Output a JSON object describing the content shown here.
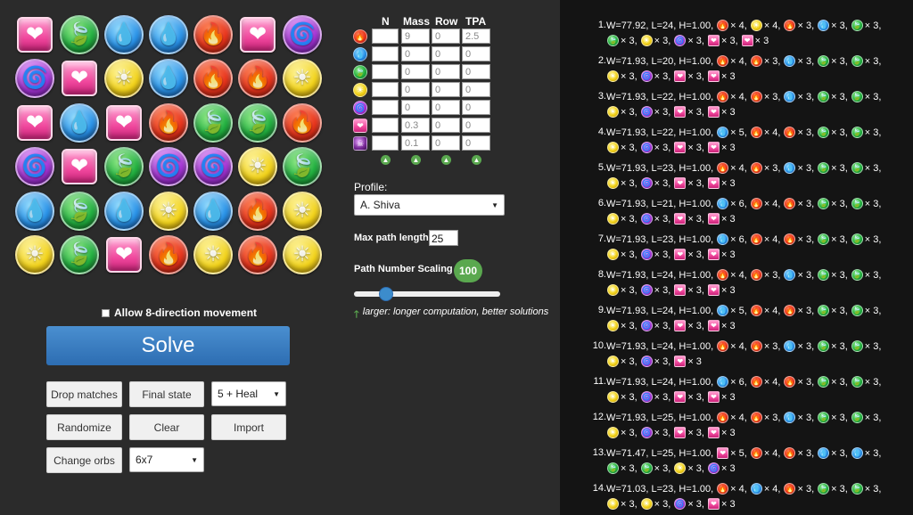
{
  "board": {
    "rows": [
      [
        "h",
        "g",
        "b",
        "b",
        "r",
        "h",
        "d"
      ],
      [
        "d",
        "h",
        "l",
        "b",
        "r",
        "r",
        "l"
      ],
      [
        "h",
        "b",
        "h",
        "r",
        "g",
        "g",
        "r"
      ],
      [
        "d",
        "h",
        "g",
        "d",
        "d",
        "l",
        "g"
      ],
      [
        "b",
        "g",
        "b",
        "l",
        "b",
        "r",
        "l"
      ],
      [
        "l",
        "g",
        "h",
        "r",
        "l",
        "r",
        "l"
      ]
    ],
    "orb_glyphs": {
      "r": "🔥",
      "b": "💧",
      "g": "🍃",
      "l": "☀",
      "d": "🌀",
      "h": "❤"
    }
  },
  "weights": {
    "headers": [
      "N",
      "Mass",
      "Row",
      "TPA"
    ],
    "rows": [
      {
        "orb": "fire",
        "n": "",
        "mass": "9",
        "row": "0",
        "tpa": "2.5"
      },
      {
        "orb": "water",
        "n": "",
        "mass": "0",
        "row": "0",
        "tpa": "0"
      },
      {
        "orb": "wood",
        "n": "",
        "mass": "0",
        "row": "0",
        "tpa": "0"
      },
      {
        "orb": "light",
        "n": "",
        "mass": "0",
        "row": "0",
        "tpa": "0"
      },
      {
        "orb": "dark",
        "n": "",
        "mass": "0",
        "row": "0",
        "tpa": "0"
      },
      {
        "orb": "heart",
        "n": "",
        "mass": "0.3",
        "row": "0",
        "tpa": "0"
      },
      {
        "orb": "poison",
        "n": "",
        "mass": "0.1",
        "row": "0",
        "tpa": "0"
      }
    ]
  },
  "profile": {
    "label": "Profile:",
    "value": "A. Shiva"
  },
  "max_path": {
    "label": "Max path length:",
    "value": "25"
  },
  "scaling": {
    "label": "Path Number Scaling",
    "value": "100",
    "slider_fraction": 0.2
  },
  "hint": {
    "text": "larger: longer computation, better solutions"
  },
  "allow8": {
    "label": "Allow 8-direction movement",
    "checked": false
  },
  "buttons": {
    "solve": "Solve",
    "drop_matches": "Drop matches",
    "final_state": "Final state",
    "randomize": "Randomize",
    "clear": "Clear",
    "import": "Import",
    "change_orbs": "Change orbs"
  },
  "selects": {
    "mode": "5 + Heal",
    "size": "6x7"
  },
  "colors": {
    "solve": "#2d6db2",
    "badge": "#5aa84f",
    "results_bg": "#141414",
    "page_bg": "#2b2b2b"
  },
  "results": [
    {
      "num": "1.",
      "head": "W=77.92, L=24, H=1.00,",
      "orbs": [
        [
          "r",
          4
        ],
        [
          "l",
          4
        ],
        [
          "r",
          3
        ],
        [
          "b",
          3
        ],
        [
          "g",
          3
        ],
        [
          "g",
          3
        ],
        [
          "l",
          3
        ],
        [
          "d",
          3
        ],
        [
          "h",
          3
        ],
        [
          "h",
          3
        ]
      ]
    },
    {
      "num": "2.",
      "head": "W=71.93, L=20, H=1.00,",
      "orbs": [
        [
          "r",
          4
        ],
        [
          "r",
          3
        ],
        [
          "b",
          3
        ],
        [
          "g",
          3
        ],
        [
          "g",
          3
        ],
        [
          "l",
          3
        ],
        [
          "d",
          3
        ],
        [
          "h",
          3
        ],
        [
          "h",
          3
        ]
      ]
    },
    {
      "num": "3.",
      "head": "W=71.93, L=22, H=1.00,",
      "orbs": [
        [
          "r",
          4
        ],
        [
          "r",
          3
        ],
        [
          "b",
          3
        ],
        [
          "g",
          3
        ],
        [
          "g",
          3
        ],
        [
          "l",
          3
        ],
        [
          "d",
          3
        ],
        [
          "h",
          3
        ],
        [
          "h",
          3
        ]
      ]
    },
    {
      "num": "4.",
      "head": "W=71.93, L=22, H=1.00,",
      "orbs": [
        [
          "b",
          5
        ],
        [
          "r",
          4
        ],
        [
          "r",
          3
        ],
        [
          "g",
          3
        ],
        [
          "g",
          3
        ],
        [
          "l",
          3
        ],
        [
          "d",
          3
        ],
        [
          "h",
          3
        ],
        [
          "h",
          3
        ]
      ]
    },
    {
      "num": "5.",
      "head": "W=71.93, L=23, H=1.00,",
      "orbs": [
        [
          "r",
          4
        ],
        [
          "r",
          3
        ],
        [
          "b",
          3
        ],
        [
          "g",
          3
        ],
        [
          "g",
          3
        ],
        [
          "l",
          3
        ],
        [
          "d",
          3
        ],
        [
          "h",
          3
        ],
        [
          "h",
          3
        ]
      ]
    },
    {
      "num": "6.",
      "head": "W=71.93, L=21, H=1.00,",
      "orbs": [
        [
          "b",
          6
        ],
        [
          "r",
          4
        ],
        [
          "r",
          3
        ],
        [
          "g",
          3
        ],
        [
          "g",
          3
        ],
        [
          "l",
          3
        ],
        [
          "d",
          3
        ],
        [
          "h",
          3
        ],
        [
          "h",
          3
        ]
      ]
    },
    {
      "num": "7.",
      "head": "W=71.93, L=23, H=1.00,",
      "orbs": [
        [
          "b",
          6
        ],
        [
          "r",
          4
        ],
        [
          "r",
          3
        ],
        [
          "g",
          3
        ],
        [
          "g",
          3
        ],
        [
          "l",
          3
        ],
        [
          "d",
          3
        ],
        [
          "h",
          3
        ],
        [
          "h",
          3
        ]
      ]
    },
    {
      "num": "8.",
      "head": "W=71.93, L=24, H=1.00,",
      "orbs": [
        [
          "r",
          4
        ],
        [
          "r",
          3
        ],
        [
          "b",
          3
        ],
        [
          "g",
          3
        ],
        [
          "g",
          3
        ],
        [
          "l",
          3
        ],
        [
          "d",
          3
        ],
        [
          "h",
          3
        ],
        [
          "h",
          3
        ]
      ]
    },
    {
      "num": "9.",
      "head": "W=71.93, L=24, H=1.00,",
      "orbs": [
        [
          "b",
          5
        ],
        [
          "r",
          4
        ],
        [
          "r",
          3
        ],
        [
          "g",
          3
        ],
        [
          "g",
          3
        ],
        [
          "l",
          3
        ],
        [
          "d",
          3
        ],
        [
          "h",
          3
        ],
        [
          "h",
          3
        ]
      ]
    },
    {
      "num": "10.",
      "head": "W=71.93, L=24, H=1.00,",
      "orbs": [
        [
          "r",
          4
        ],
        [
          "r",
          3
        ],
        [
          "b",
          3
        ],
        [
          "g",
          3
        ],
        [
          "g",
          3
        ],
        [
          "l",
          3
        ],
        [
          "d",
          3
        ],
        [
          "h",
          3
        ]
      ]
    },
    {
      "num": "11.",
      "head": "W=71.93, L=24, H=1.00,",
      "orbs": [
        [
          "b",
          6
        ],
        [
          "r",
          4
        ],
        [
          "r",
          3
        ],
        [
          "g",
          3
        ],
        [
          "g",
          3
        ],
        [
          "l",
          3
        ],
        [
          "d",
          3
        ],
        [
          "h",
          3
        ],
        [
          "h",
          3
        ]
      ]
    },
    {
      "num": "12.",
      "head": "W=71.93, L=25, H=1.00,",
      "orbs": [
        [
          "r",
          4
        ],
        [
          "r",
          3
        ],
        [
          "b",
          3
        ],
        [
          "g",
          3
        ],
        [
          "g",
          3
        ],
        [
          "l",
          3
        ],
        [
          "d",
          3
        ],
        [
          "h",
          3
        ],
        [
          "h",
          3
        ]
      ]
    },
    {
      "num": "13.",
      "head": "W=71.47, L=25, H=1.00,",
      "orbs": [
        [
          "h",
          5
        ],
        [
          "r",
          4
        ],
        [
          "r",
          3
        ],
        [
          "b",
          3
        ],
        [
          "b",
          3
        ],
        [
          "g",
          3
        ],
        [
          "g",
          3
        ],
        [
          "l",
          3
        ],
        [
          "d",
          3
        ]
      ]
    },
    {
      "num": "14.",
      "head": "W=71.03, L=23, H=1.00,",
      "orbs": [
        [
          "r",
          4
        ],
        [
          "b",
          4
        ],
        [
          "r",
          3
        ],
        [
          "g",
          3
        ],
        [
          "g",
          3
        ],
        [
          "l",
          3
        ],
        [
          "l",
          3
        ],
        [
          "d",
          3
        ],
        [
          "h",
          3
        ]
      ]
    }
  ]
}
